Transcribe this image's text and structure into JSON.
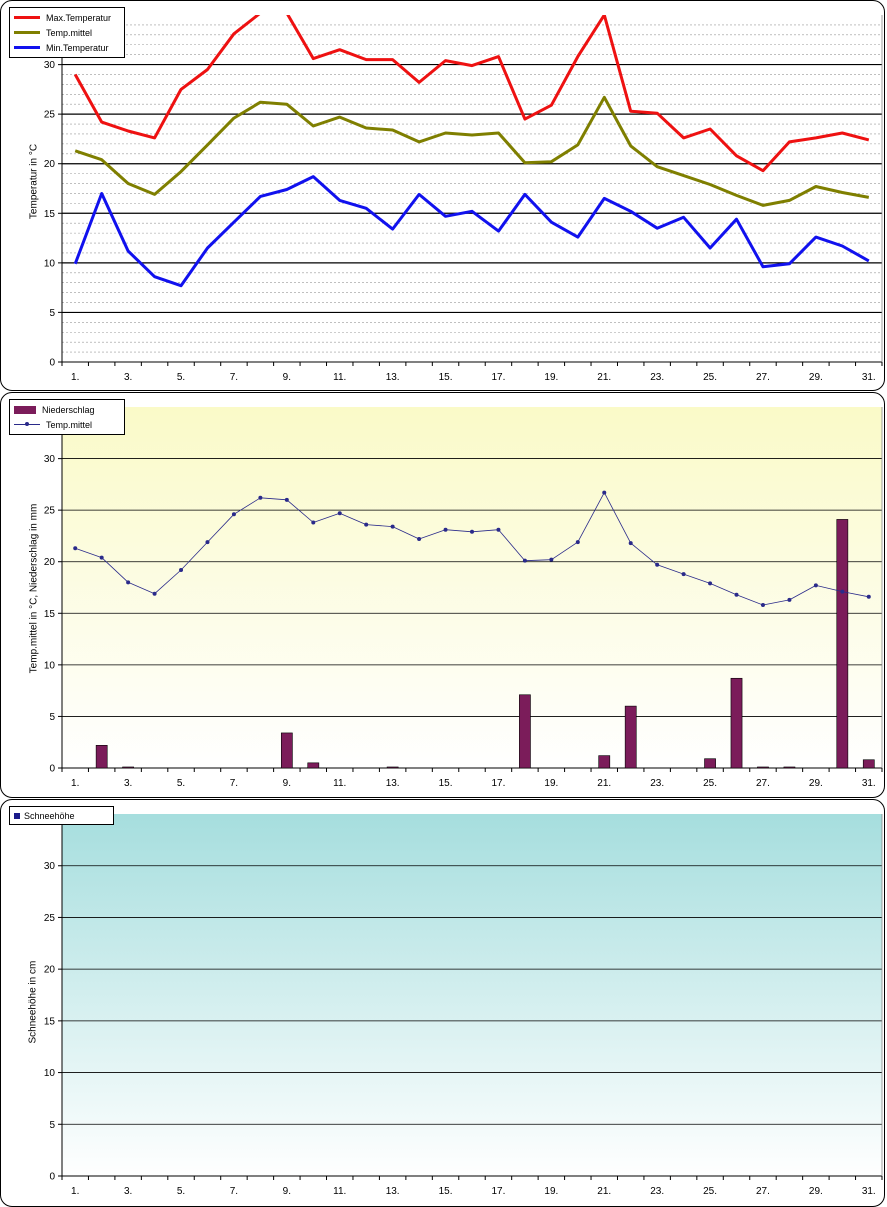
{
  "colors": {
    "max_temp": "#ee1111",
    "mean_temp": "#7f7f00",
    "min_temp": "#1111ee",
    "precip_bar": "#7b1c5a",
    "mean_line2": "#2a2a8a",
    "snow_swatch": "#1a1a8a"
  },
  "x_tick_labels": [
    "1.",
    "3.",
    "5.",
    "7.",
    "9.",
    "11.",
    "13.",
    "15.",
    "17.",
    "19.",
    "21.",
    "23.",
    "25.",
    "27.",
    "29.",
    "31."
  ],
  "chart_data": [
    {
      "type": "line",
      "ylabel": "Temperatur  in °C",
      "ylim": [
        0,
        35
      ],
      "y_ticks": [
        0,
        5,
        10,
        15,
        20,
        25,
        30
      ],
      "legend": [
        "Max.Temperatur",
        "Temp.mittel",
        "Min.Temperatur"
      ],
      "x": [
        1,
        2,
        3,
        4,
        5,
        6,
        7,
        8,
        9,
        10,
        11,
        12,
        13,
        14,
        15,
        16,
        17,
        18,
        19,
        20,
        21,
        22,
        23,
        24,
        25,
        26,
        27,
        28,
        29,
        30,
        31
      ],
      "series": [
        {
          "name": "Max.Temperatur",
          "values": [
            29.0,
            24.2,
            23.3,
            22.6,
            27.5,
            29.5,
            33.1,
            35.2,
            35.2,
            30.6,
            31.5,
            30.5,
            30.5,
            28.2,
            30.4,
            29.9,
            30.8,
            24.5,
            25.9,
            30.8,
            35.0,
            25.3,
            25.1,
            22.6,
            23.5,
            20.8,
            19.3,
            22.2,
            22.6,
            23.1,
            22.4
          ]
        },
        {
          "name": "Temp.mittel",
          "values": [
            21.3,
            20.4,
            18.0,
            16.9,
            19.2,
            21.9,
            24.6,
            26.2,
            26.0,
            23.8,
            24.7,
            23.6,
            23.4,
            22.2,
            23.1,
            22.9,
            23.1,
            20.1,
            20.2,
            21.9,
            26.7,
            21.8,
            19.7,
            18.8,
            17.9,
            16.8,
            15.8,
            16.3,
            17.7,
            17.1,
            16.6
          ]
        },
        {
          "name": "Min.Temperatur",
          "values": [
            9.9,
            17.0,
            11.2,
            8.6,
            7.7,
            11.5,
            14.1,
            16.7,
            17.4,
            18.7,
            16.3,
            15.5,
            13.4,
            16.9,
            14.7,
            15.2,
            13.2,
            16.9,
            14.1,
            12.6,
            16.5,
            15.2,
            13.5,
            14.6,
            11.5,
            14.4,
            9.6,
            9.9,
            12.6,
            11.7,
            10.2
          ]
        }
      ]
    },
    {
      "type": "bar",
      "ylabel": "Temp.mittel  in °C, Niederschlag in mm",
      "ylim": [
        0,
        35
      ],
      "y_ticks": [
        0,
        5,
        10,
        15,
        20,
        25,
        30
      ],
      "legend": [
        "Niederschlag",
        "Temp.mittel"
      ],
      "x": [
        1,
        2,
        3,
        4,
        5,
        6,
        7,
        8,
        9,
        10,
        11,
        12,
        13,
        14,
        15,
        16,
        17,
        18,
        19,
        20,
        21,
        22,
        23,
        24,
        25,
        26,
        27,
        28,
        29,
        30,
        31
      ],
      "series": [
        {
          "name": "Niederschlag",
          "type": "bar",
          "values": [
            0,
            2.2,
            0.1,
            0,
            0,
            0,
            0,
            0,
            3.4,
            0.5,
            0,
            0,
            0.1,
            0,
            0,
            0,
            0,
            7.1,
            0,
            0,
            1.2,
            6.0,
            0,
            0,
            0.9,
            8.7,
            0.1,
            0.1,
            0,
            24.1,
            0.8
          ]
        },
        {
          "name": "Temp.mittel",
          "type": "line",
          "values": [
            21.3,
            20.4,
            18.0,
            16.9,
            19.2,
            21.9,
            24.6,
            26.2,
            26.0,
            23.8,
            24.7,
            23.6,
            23.4,
            22.2,
            23.1,
            22.9,
            23.1,
            20.1,
            20.2,
            21.9,
            26.7,
            21.8,
            19.7,
            18.8,
            17.9,
            16.8,
            15.8,
            16.3,
            17.7,
            17.1,
            16.6
          ]
        }
      ]
    },
    {
      "type": "bar",
      "ylabel": "Schneehöhe in cm",
      "ylim": [
        0,
        35
      ],
      "y_ticks": [
        0,
        5,
        10,
        15,
        20,
        25,
        30
      ],
      "legend": [
        "Schneehöhe"
      ],
      "x": [
        1,
        2,
        3,
        4,
        5,
        6,
        7,
        8,
        9,
        10,
        11,
        12,
        13,
        14,
        15,
        16,
        17,
        18,
        19,
        20,
        21,
        22,
        23,
        24,
        25,
        26,
        27,
        28,
        29,
        30,
        31
      ],
      "series": [
        {
          "name": "Schneehöhe",
          "values": [
            0,
            0,
            0,
            0,
            0,
            0,
            0,
            0,
            0,
            0,
            0,
            0,
            0,
            0,
            0,
            0,
            0,
            0,
            0,
            0,
            0,
            0,
            0,
            0,
            0,
            0,
            0,
            0,
            0,
            0,
            0
          ]
        }
      ]
    }
  ]
}
